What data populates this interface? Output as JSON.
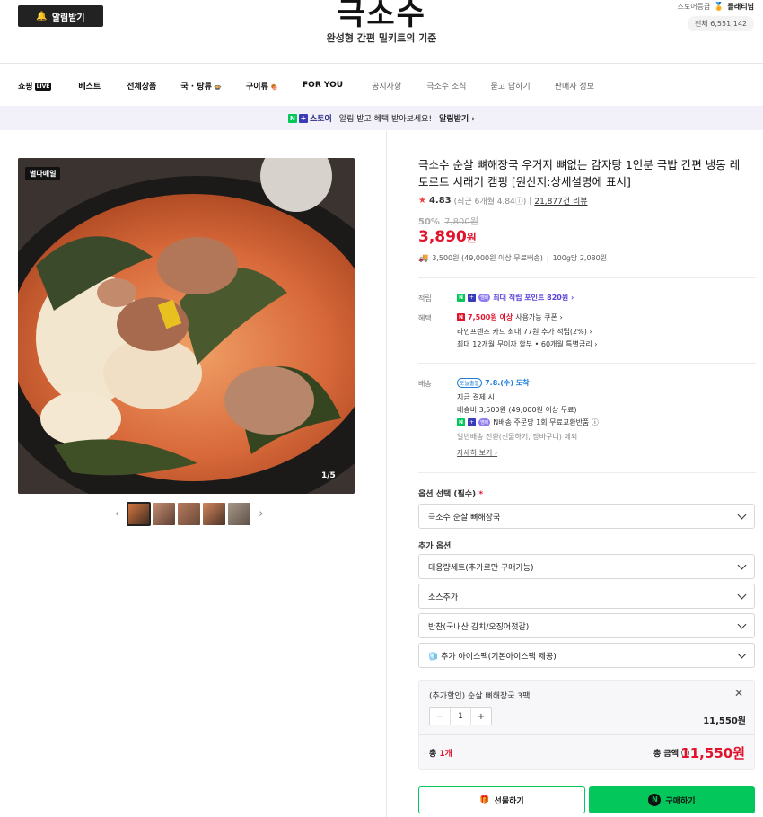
{
  "header": {
    "notify_button": "알림받기",
    "logo": "극소수",
    "tagline": "완성형 간편 밀키트의 기준",
    "grade_label": "스토어등급",
    "grade_value": "플래티넘",
    "visits": "전체 6,551,142"
  },
  "nav": {
    "items": [
      {
        "label": "쇼핑",
        "badge": "LIVE",
        "style": "strong"
      },
      {
        "label": "베스트",
        "style": "strong"
      },
      {
        "label": "전체상품",
        "style": "strong"
      },
      {
        "label": "국 · 탕류",
        "style": "strong"
      },
      {
        "label": "구이류",
        "style": "strong"
      },
      {
        "label": "FOR YOU",
        "style": "strong"
      },
      {
        "label": "공지사항",
        "style": "light"
      },
      {
        "label": "극소수 소식",
        "style": "light"
      },
      {
        "label": "묻고 답하기",
        "style": "light"
      },
      {
        "label": "판매자 정보",
        "style": "light"
      }
    ]
  },
  "banner": {
    "brand": "스토어",
    "text": "알림 받고 혜택 받아보세요!",
    "link": "알림받기 ›"
  },
  "gallery": {
    "badge": "별다매일",
    "counter": "1/5",
    "prev": "‹",
    "next": "›"
  },
  "product": {
    "title": "극소수 순살 뼈해장국 우거지 뼈없는 감자탕 1인분 국밥 간편 냉동 레토르트 시래기 캠핑 [원산지:상세설명에 표시]",
    "rating": "4.83",
    "rating_sub": "(최근 6개월 4.84ⓘ)",
    "reviews": "21,877건 리뷰",
    "discount_pct": "50%",
    "original_price": "7,800원",
    "price": "3,890",
    "price_unit": "원",
    "shipping_line": "3,500원 (49,000원 이상 무료배송)",
    "unit_price": "100g당 2,080원"
  },
  "benefits": {
    "points_label": "적립",
    "points_text": "최대 적립 포인트 820원 ›",
    "benefit_label": "혜택",
    "coupon_text": "7,500원 이상",
    "coupon_suffix": "사용가능 쿠폰 ›",
    "card_text": "라인프렌즈 카드 최대 77원 추가 적립(2%) ›",
    "installment_text": "최대 12개월 무이자 할부 • 60개월 특별금리 ›"
  },
  "delivery": {
    "label": "배송",
    "today_tag": "오늘출발",
    "arrival": "7.8.(수) 도착",
    "pay_now": "지금 결제 시",
    "fee": "배송비 3,500원 (49,000원 이상 무료)",
    "exchange": "N배송 주문당 1회 무료교환반품 ⓘ",
    "normal": "일반배송 전환(선물하기, 장바구니) 제외",
    "details": "자세히 보기 ›"
  },
  "options": {
    "required_label": "옵션 선택 (필수)",
    "required_mark": "*",
    "required_value": "극소수 순살 뼈해장국",
    "extra_label": "추가 옵션",
    "extras": [
      "대용량세트(추가로만 구매가능)",
      "소스추가",
      "반찬(국내산 김치/오징어젓갈)",
      "🧊 추가 아이스팩(기본아이스팩 제공)"
    ]
  },
  "selected": {
    "name": "(추가할인) 순살 뼈해장국 3팩",
    "close": "✕",
    "minus": "−",
    "qty": "1",
    "plus": "+",
    "price": "11,550원",
    "total_prefix": "총",
    "total_count": "1개",
    "total_label": "총 금액 ⓘ",
    "total_price": "11,550원"
  },
  "actions": {
    "gift": "선물하기",
    "buy": "구매하기"
  }
}
